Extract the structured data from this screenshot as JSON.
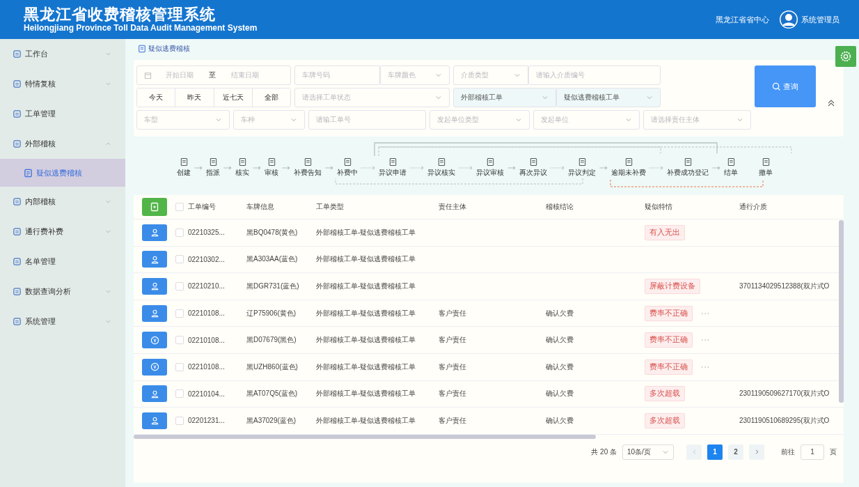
{
  "header": {
    "title": "黑龙江省收费稽核管理系统",
    "subtitle": "Heilongjiang Province Toll Data Audit Management System",
    "org": "黑龙江省省中心",
    "user": "系统管理员"
  },
  "sidebar": {
    "items": [
      {
        "label": "工作台",
        "expanded": false,
        "selected": false
      },
      {
        "label": "特情复核",
        "expanded": false,
        "selected": false
      },
      {
        "label": "工单管理",
        "selected": false
      },
      {
        "label": "外部稽核",
        "expanded": true,
        "selected": false,
        "children": [
          {
            "label": "疑似逃费稽核",
            "selected": true
          }
        ]
      },
      {
        "label": "内部稽核",
        "expanded": false,
        "selected": false
      },
      {
        "label": "通行费补费",
        "expanded": false,
        "selected": false
      },
      {
        "label": "名单管理",
        "selected": false
      },
      {
        "label": "数据查询分析",
        "expanded": false,
        "selected": false
      },
      {
        "label": "系统管理",
        "expanded": false,
        "selected": false
      }
    ]
  },
  "breadcrumb": "疑似逃费稽核",
  "filters": {
    "fields": [
      {
        "kind": "date-range",
        "start_placeholder": "开始日期",
        "separator": "至",
        "end_placeholder": "结束日期"
      },
      {
        "kind": "input",
        "placeholder": "车牌号码"
      },
      {
        "kind": "select",
        "placeholder": "车牌颜色"
      },
      {
        "kind": "select",
        "placeholder": "介质类型"
      },
      {
        "kind": "input",
        "placeholder": "请输入介质编号"
      },
      {
        "kind": "quick",
        "options": [
          "今天",
          "昨天",
          "近七天",
          "全部"
        ]
      },
      {
        "kind": "select",
        "placeholder": "请选择工单状态"
      },
      {
        "kind": "select",
        "value": "外部稽核工单"
      },
      {
        "kind": "select",
        "value": "疑似逃费稽核工单"
      },
      {
        "kind": "select",
        "placeholder": "车型"
      },
      {
        "kind": "select",
        "placeholder": "车种"
      },
      {
        "kind": "input",
        "placeholder": "请输工单号"
      },
      {
        "kind": "select",
        "placeholder": "发起单位类型"
      },
      {
        "kind": "select",
        "placeholder": "发起单位"
      },
      {
        "kind": "select",
        "placeholder": "请选择责任主体"
      }
    ],
    "query_button": "查询"
  },
  "flow": [
    {
      "label": "创建",
      "arrow": true,
      "dashed": false
    },
    {
      "label": "指派",
      "arrow": true,
      "dashed": false
    },
    {
      "label": "核实",
      "arrow": true,
      "dashed": false
    },
    {
      "label": "审核",
      "arrow": true,
      "dashed": false
    },
    {
      "label": "补费告知",
      "arrow": true,
      "dashed": false
    },
    {
      "label": "补费中",
      "arrow": true,
      "dashed": true
    },
    {
      "label": "异议申请",
      "arrow": true,
      "dashed": true
    },
    {
      "label": "异议核实",
      "arrow": true,
      "dashed": true
    },
    {
      "label": "异议审核",
      "arrow": true,
      "dashed": false
    },
    {
      "label": "再次异议",
      "arrow": true,
      "dashed": true
    },
    {
      "label": "异议判定",
      "arrow": true,
      "dashed": false
    },
    {
      "label": "逾期未补费",
      "arrow": true,
      "dashed": true
    },
    {
      "label": "补费成功登记",
      "arrow": true,
      "dashed": false
    },
    {
      "label": "结单",
      "arrow": false
    },
    {
      "label": "撤单",
      "arrow": false
    }
  ],
  "table": {
    "columns": [
      "工单编号",
      "车牌信息",
      "工单类型",
      "责任主体",
      "稽核结论",
      "疑似特情",
      "通行介质"
    ],
    "all_checked": false,
    "rows": [
      {
        "kind": "person",
        "checked": false,
        "id": "02210325...",
        "plate": "黑BQ0478(黄色)",
        "type": "外部稽核工单-疑似逃费稽核工单",
        "party": "",
        "conclusion": "",
        "tag": "有入无出",
        "more": false,
        "medium": ""
      },
      {
        "kind": "person",
        "checked": false,
        "id": "02210302...",
        "plate": "黑A303AA(蓝色)",
        "type": "外部稽核工单-疑似逃费稽核工单",
        "party": "",
        "conclusion": "",
        "tag": "",
        "more": false,
        "medium": ""
      },
      {
        "kind": "person",
        "checked": false,
        "id": "02210210...",
        "plate": "黑DGR731(蓝色)",
        "type": "外部稽核工单-疑似逃费稽核工单",
        "party": "",
        "conclusion": "",
        "tag": "屏蔽计费设备",
        "more": false,
        "medium": "3701134029512388(双片式O"
      },
      {
        "kind": "person",
        "checked": false,
        "id": "02210108...",
        "plate": "辽P75906(黄色)",
        "type": "外部稽核工单-疑似逃费稽核工单",
        "party": "客户责任",
        "conclusion": "确认欠费",
        "tag": "费率不正确",
        "more": true,
        "medium": ""
      },
      {
        "kind": "yen",
        "checked": false,
        "id": "02210108...",
        "plate": "黑D07679(黑色)",
        "type": "外部稽核工单-疑似逃费稽核工单",
        "party": "客户责任",
        "conclusion": "确认欠费",
        "tag": "费率不正确",
        "more": true,
        "medium": ""
      },
      {
        "kind": "yen",
        "checked": false,
        "id": "02210108...",
        "plate": "黑UZH860(蓝色)",
        "type": "外部稽核工单-疑似逃费稽核工单",
        "party": "客户责任",
        "conclusion": "确认欠费",
        "tag": "费率不正确",
        "more": true,
        "medium": ""
      },
      {
        "kind": "person",
        "checked": false,
        "id": "02210104...",
        "plate": "黑AT07Q5(蓝色)",
        "type": "外部稽核工单-疑似逃费稽核工单",
        "party": "客户责任",
        "conclusion": "确认欠费",
        "tag": "多次超载",
        "more": false,
        "medium": "2301190509627170(双片式O"
      },
      {
        "kind": "person",
        "checked": false,
        "id": "02201231...",
        "plate": "黑A37029(蓝色)",
        "type": "外部稽核工单-疑似逃费稽核工单",
        "party": "客户责任",
        "conclusion": "确认欠费",
        "tag": "多次超载",
        "more": false,
        "medium": "2301190510689295(双片式O"
      }
    ]
  },
  "pagination": {
    "total": "共 20 条",
    "page_size": "10条/页",
    "pages": [
      {
        "label": "1",
        "selected": true
      },
      {
        "label": "2",
        "selected": false
      }
    ],
    "goto_label": "前往",
    "goto_value": "1",
    "page_unit": "页"
  }
}
